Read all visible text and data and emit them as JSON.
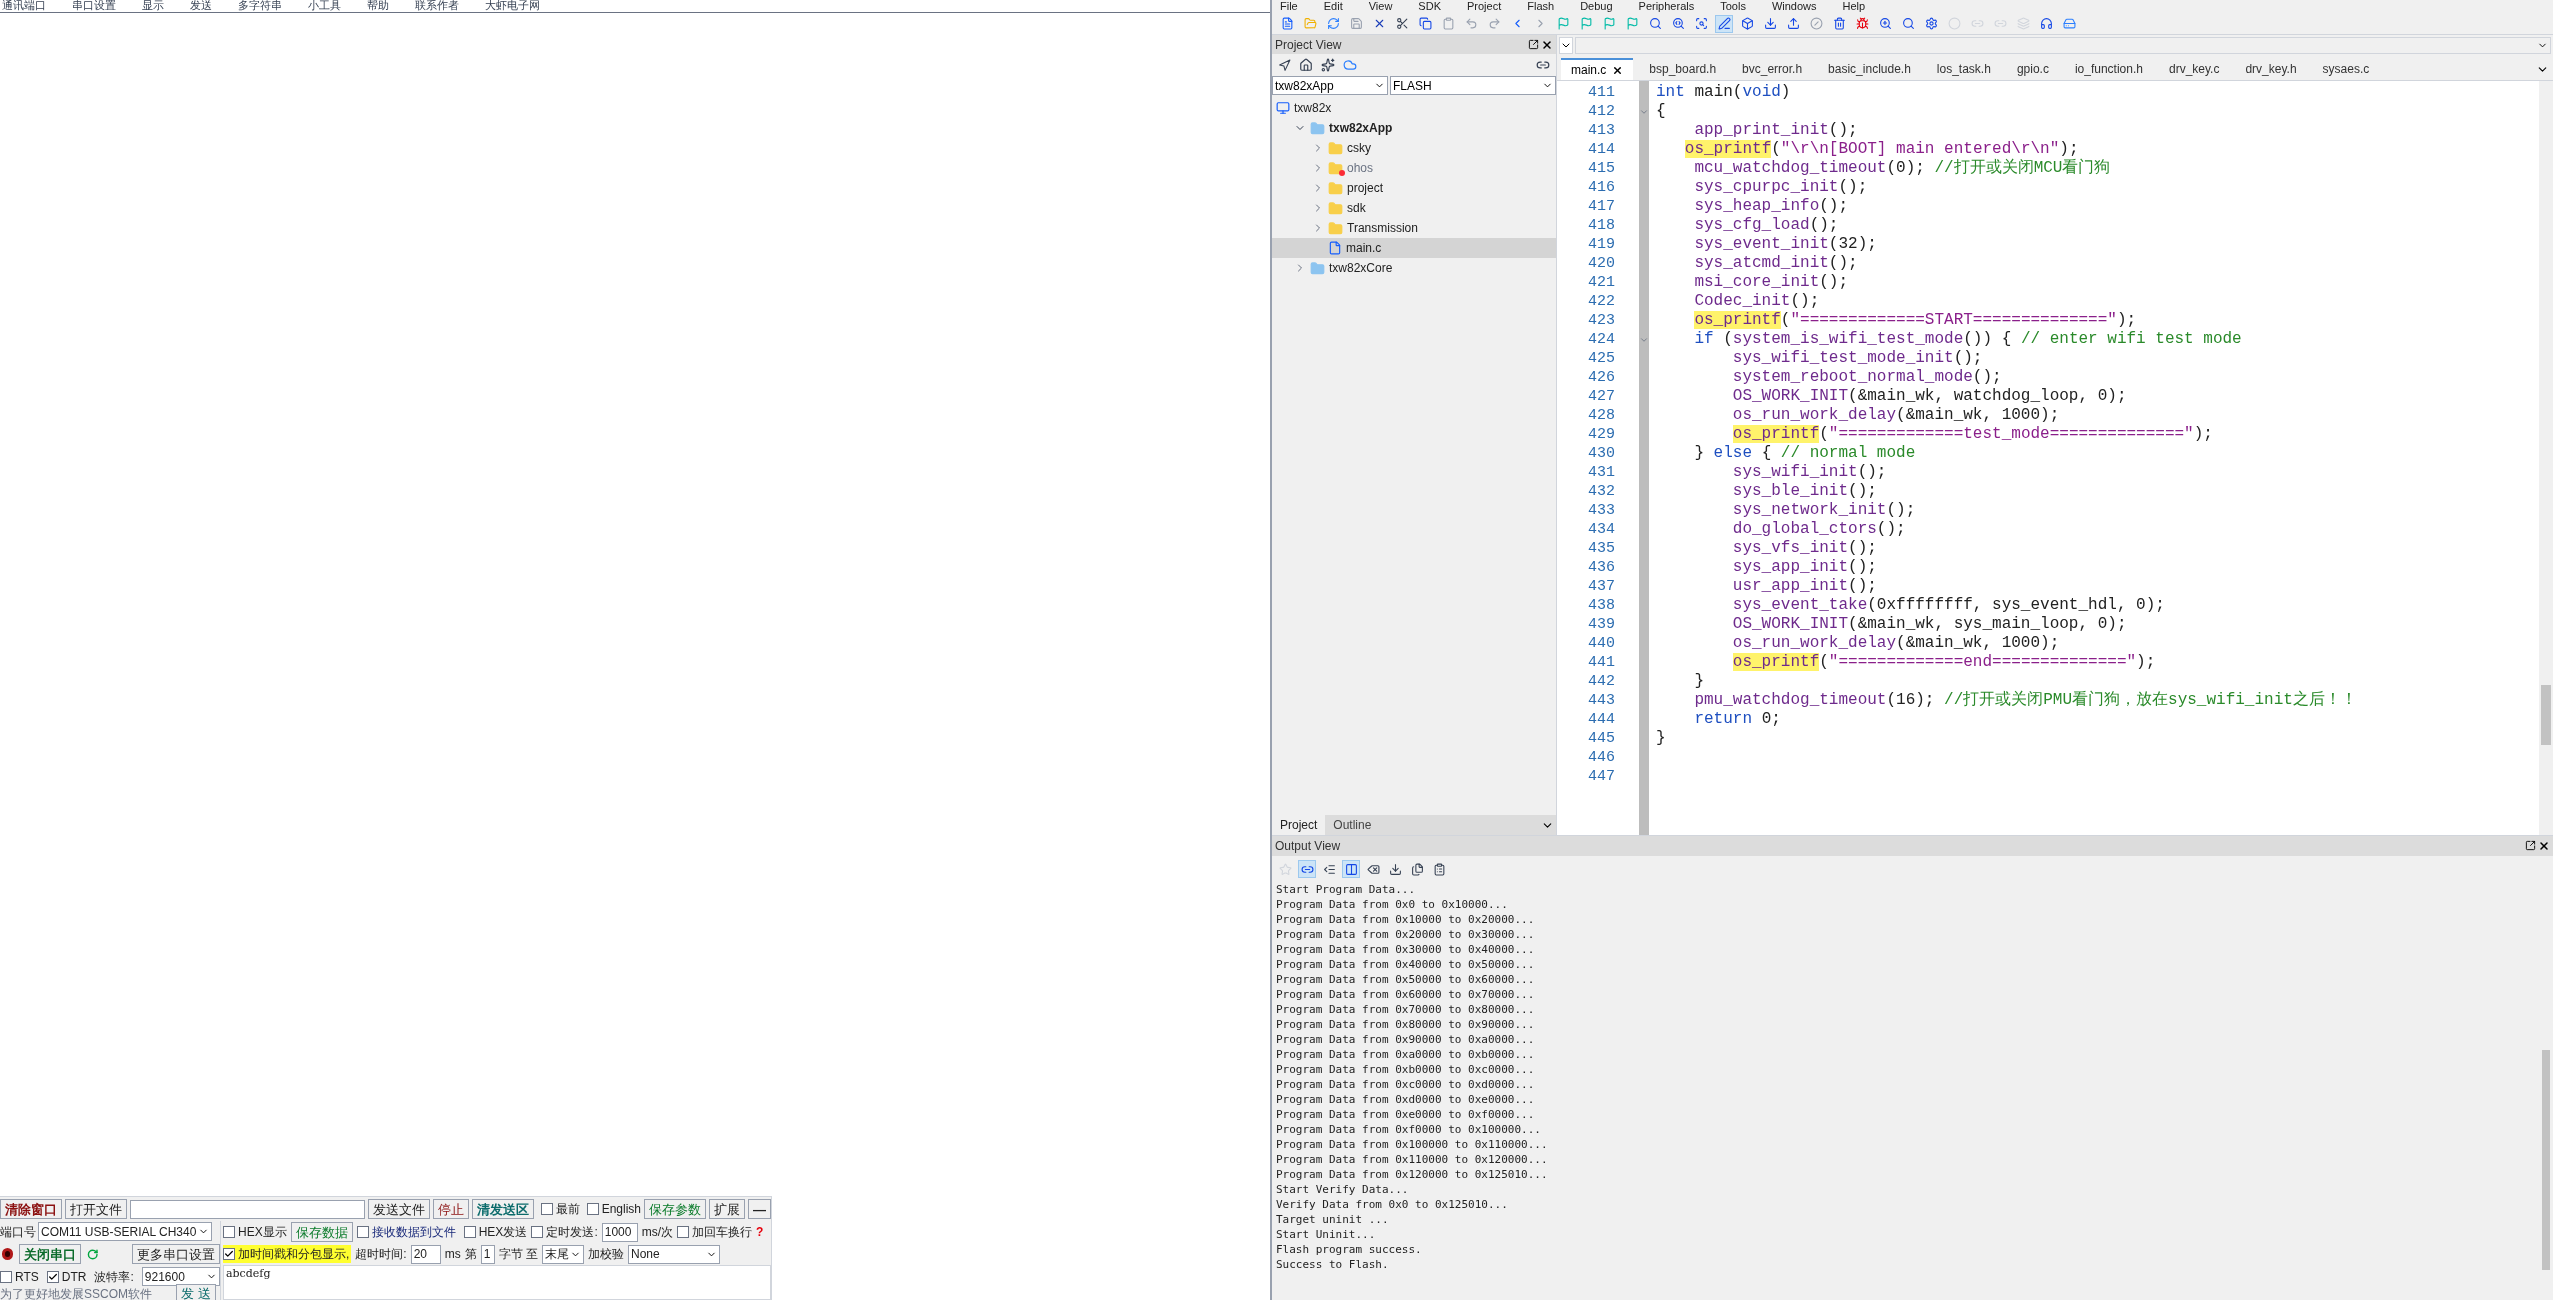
{
  "serial_tool": {
    "menu": [
      "通讯端口",
      "串口设置",
      "显示",
      "发送",
      "多字符串",
      "小工具",
      "帮助",
      "联系作者",
      "大虾电子网"
    ],
    "clear_window_button": "清除窗口",
    "open_file_button": "打开文件",
    "send_file_button": "发送文件",
    "stop_button": "停止",
    "clear_send_button": "清发送区",
    "topmost": {
      "label": "最前",
      "checked": false
    },
    "english": {
      "label": "English",
      "checked": false
    },
    "save_params_button": "保存参数",
    "expand_button": "扩展",
    "collapse_button": "—",
    "port_label": "端口号",
    "port": {
      "value": "COM11 USB-SERIAL CH340"
    },
    "hex_display": {
      "label": "HEX显示",
      "checked": false
    },
    "save_data_button": "保存数据",
    "receive_to_file": {
      "label": "接收数据到文件",
      "checked": false
    },
    "hex_send": {
      "label": "HEX发送",
      "checked": false
    },
    "timed_send": {
      "label": "定时发送:",
      "checked": false
    },
    "interval": {
      "value": "1000"
    },
    "interval_unit": "ms/次",
    "append_crlf": {
      "label": "加回车换行",
      "checked": false
    },
    "help_mark": "?",
    "port_open": true,
    "close_port_button": "关闭串口",
    "more_settings_button": "更多串口设置",
    "timestamp": {
      "label": "加时间戳和分包显示,",
      "checked": true
    },
    "timeout_label": "超时时间:",
    "timeout": {
      "value": "20"
    },
    "timeout_unit": "ms",
    "byte_from_label": "第",
    "byte_from": {
      "value": "1"
    },
    "byte_to_label": "字节 至",
    "byte_to": {
      "value": "末尾"
    },
    "checksum_label": "加校验",
    "checksum": {
      "value": "None"
    },
    "rts": {
      "label": "RTS",
      "checked": false
    },
    "dtr": {
      "label": "DTR",
      "checked": true
    },
    "baud_label": "波特率:",
    "baud": {
      "value": "921600"
    },
    "send_text": {
      "value": "abcdefg"
    },
    "promo": "为了更好地发展SSCOM软件",
    "send_button": "发 送"
  },
  "ide": {
    "menu": [
      "File",
      "Edit",
      "View",
      "SDK",
      "Project",
      "Flash",
      "Debug",
      "Peripherals",
      "Tools",
      "Windows",
      "Help"
    ],
    "toolbar": [
      {
        "on": false
      },
      {
        "on": false
      },
      {
        "on": false
      },
      {
        "on": false
      },
      {
        "on": false
      },
      {
        "on": false
      },
      {
        "on": false
      },
      {
        "on": false
      },
      {
        "on": false
      },
      {
        "on": false
      },
      {
        "on": false
      },
      {
        "on": false
      },
      {
        "on": false
      },
      {
        "on": false
      },
      {
        "on": false
      },
      {
        "on": false
      },
      {
        "on": false
      },
      {
        "on": false
      },
      {
        "on": false
      },
      {
        "on": true
      },
      {
        "on": false
      },
      {
        "on": false
      },
      {
        "on": false
      },
      {
        "on": false
      },
      {
        "on": false
      },
      {
        "on": false
      },
      {
        "on": false
      },
      {
        "on": false
      },
      {
        "on": false
      },
      {
        "on": false
      },
      {
        "on": false
      },
      {
        "on": false
      },
      {
        "on": false
      },
      {
        "on": false
      },
      {
        "on": false
      }
    ],
    "project_view": {
      "title": "Project View",
      "target": {
        "value": "txw82xApp"
      },
      "config": {
        "value": "FLASH"
      },
      "tree": [
        {
          "label": "txw82x",
          "kind": "workspace",
          "selected": false,
          "children": [
            {
              "label": "txw82xApp",
              "kind": "project",
              "expanded": true,
              "selected": false,
              "children": [
                {
                  "label": "csky",
                  "kind": "folder",
                  "expanded": false,
                  "selected": false,
                  "excluded": false
                },
                {
                  "label": "ohos",
                  "kind": "folder",
                  "expanded": false,
                  "selected": false,
                  "excluded": true
                },
                {
                  "label": "project",
                  "kind": "folder",
                  "expanded": false,
                  "selected": false,
                  "excluded": false
                },
                {
                  "label": "sdk",
                  "kind": "folder",
                  "expanded": false,
                  "selected": false,
                  "excluded": false
                },
                {
                  "label": "Transmission",
                  "kind": "folder",
                  "expanded": false,
                  "selected": false,
                  "excluded": false
                },
                {
                  "label": "main.c",
                  "kind": "file",
                  "selected": true
                }
              ]
            },
            {
              "label": "txw82xCore",
              "kind": "project",
              "expanded": false,
              "selected": false
            }
          ]
        }
      ],
      "tabs": [
        {
          "label": "Project",
          "selected": true
        },
        {
          "label": "Outline",
          "selected": false
        }
      ]
    },
    "editor": {
      "tabs": [
        {
          "label": "main.c",
          "selected": true,
          "closable": true
        },
        {
          "label": "bsp_board.h",
          "selected": false
        },
        {
          "label": "bvc_error.h",
          "selected": false
        },
        {
          "label": "basic_include.h",
          "selected": false
        },
        {
          "label": "los_task.h",
          "selected": false
        },
        {
          "label": "gpio.c",
          "selected": false
        },
        {
          "label": "io_function.h",
          "selected": false
        },
        {
          "label": "drv_key.c",
          "selected": false
        },
        {
          "label": "drv_key.h",
          "selected": false
        },
        {
          "label": "sysaes.c",
          "selected": false
        }
      ],
      "lines": [
        {
          "number": "411",
          "segments": [
            {
              "kind": "kw",
              "text": "int"
            },
            {
              "kind": "txt",
              "text": " main("
            },
            {
              "kind": "kw",
              "text": "void"
            },
            {
              "kind": "txt",
              "text": ")"
            }
          ]
        },
        {
          "number": "412",
          "fold": true,
          "segments": [
            {
              "kind": "txt",
              "text": "{"
            }
          ]
        },
        {
          "number": "413",
          "segments": [
            {
              "kind": "fn",
              "text": "    app_print_init"
            },
            {
              "kind": "txt",
              "text": "();"
            }
          ]
        },
        {
          "number": "414",
          "segments": [
            {
              "kind": "hl",
              "text": "   os_printf"
            },
            {
              "kind": "txt",
              "text": "("
            },
            {
              "kind": "str",
              "text": "\"\\r\\n[BOOT] main entered\\r\\n\""
            },
            {
              "kind": "txt",
              "text": ");"
            }
          ]
        },
        {
          "number": "415",
          "segments": [
            {
              "kind": "fn",
              "text": "    mcu_watchdog_timeout"
            },
            {
              "kind": "txt",
              "text": "(0); "
            },
            {
              "kind": "cmt",
              "text": "//打开或关闭MCU看门狗"
            }
          ]
        },
        {
          "number": "416",
          "segments": [
            {
              "kind": "fn",
              "text": "    sys_cpurpc_init"
            },
            {
              "kind": "txt",
              "text": "();"
            }
          ]
        },
        {
          "number": "417",
          "segments": [
            {
              "kind": "fn",
              "text": "    sys_heap_info"
            },
            {
              "kind": "txt",
              "text": "();"
            }
          ]
        },
        {
          "number": "418",
          "segments": [
            {
              "kind": "fn",
              "text": "    sys_cfg_load"
            },
            {
              "kind": "txt",
              "text": "();"
            }
          ]
        },
        {
          "number": "419",
          "segments": [
            {
              "kind": "fn",
              "text": "    sys_event_init"
            },
            {
              "kind": "txt",
              "text": "(32);"
            }
          ]
        },
        {
          "number": "420",
          "segments": [
            {
              "kind": "fn",
              "text": "    sys_atcmd_init"
            },
            {
              "kind": "txt",
              "text": "();"
            }
          ]
        },
        {
          "number": "421",
          "segments": [
            {
              "kind": "fn",
              "text": "    msi_core_init"
            },
            {
              "kind": "txt",
              "text": "();"
            }
          ]
        },
        {
          "number": "422",
          "segments": [
            {
              "kind": "fn",
              "text": "    Codec_init"
            },
            {
              "kind": "txt",
              "text": "();"
            }
          ]
        },
        {
          "number": "423",
          "segments": [
            {
              "kind": "hl",
              "text": "    os_printf"
            },
            {
              "kind": "txt",
              "text": "("
            },
            {
              "kind": "str",
              "text": "\"=============START==============\""
            },
            {
              "kind": "txt",
              "text": ");"
            }
          ]
        },
        {
          "number": "424",
          "fold": true,
          "segments": [
            {
              "kind": "kw",
              "text": "    if"
            },
            {
              "kind": "txt",
              "text": " ("
            },
            {
              "kind": "fn",
              "text": "system_is_wifi_test_mode"
            },
            {
              "kind": "txt",
              "text": "()) { "
            },
            {
              "kind": "cmt",
              "text": "// enter wifi test mode"
            }
          ]
        },
        {
          "number": "425",
          "segments": [
            {
              "kind": "fn",
              "text": "        sys_wifi_test_mode_init"
            },
            {
              "kind": "txt",
              "text": "();"
            }
          ]
        },
        {
          "number": "426",
          "segments": [
            {
              "kind": "fn",
              "text": "        system_reboot_normal_mode"
            },
            {
              "kind": "txt",
              "text": "();"
            }
          ]
        },
        {
          "number": "427",
          "segments": [
            {
              "kind": "fn",
              "text": "        OS_WORK_INIT"
            },
            {
              "kind": "txt",
              "text": "(&main_wk, watchdog_loop, 0);"
            }
          ]
        },
        {
          "number": "428",
          "segments": [
            {
              "kind": "fn",
              "text": "        os_run_work_delay"
            },
            {
              "kind": "txt",
              "text": "(&main_wk, 1000);"
            }
          ]
        },
        {
          "number": "429",
          "segments": [
            {
              "kind": "hl",
              "text": "        os_printf"
            },
            {
              "kind": "txt",
              "text": "("
            },
            {
              "kind": "str",
              "text": "\"=============test_mode==============\""
            },
            {
              "kind": "txt",
              "text": ");"
            }
          ]
        },
        {
          "number": "430",
          "segments": [
            {
              "kind": "txt",
              "text": "    } "
            },
            {
              "kind": "kw",
              "text": "else"
            },
            {
              "kind": "txt",
              "text": " { "
            },
            {
              "kind": "cmt",
              "text": "// normal mode"
            }
          ]
        },
        {
          "number": "431",
          "segments": [
            {
              "kind": "fn",
              "text": "        sys_wifi_init"
            },
            {
              "kind": "txt",
              "text": "();"
            }
          ]
        },
        {
          "number": "432",
          "segments": [
            {
              "kind": "fn",
              "text": "        sys_ble_init"
            },
            {
              "kind": "txt",
              "text": "();"
            }
          ]
        },
        {
          "number": "433",
          "segments": [
            {
              "kind": "fn",
              "text": "        sys_network_init"
            },
            {
              "kind": "txt",
              "text": "();"
            }
          ]
        },
        {
          "number": "434",
          "segments": [
            {
              "kind": "fn",
              "text": "        do_global_ctors"
            },
            {
              "kind": "txt",
              "text": "();"
            }
          ]
        },
        {
          "number": "435",
          "segments": [
            {
              "kind": "fn",
              "text": "        sys_vfs_init"
            },
            {
              "kind": "txt",
              "text": "();"
            }
          ]
        },
        {
          "number": "436",
          "segments": [
            {
              "kind": "fn",
              "text": "        sys_app_init"
            },
            {
              "kind": "txt",
              "text": "();"
            }
          ]
        },
        {
          "number": "437",
          "segments": [
            {
              "kind": "fn",
              "text": "        usr_app_init"
            },
            {
              "kind": "txt",
              "text": "();"
            }
          ]
        },
        {
          "number": "438",
          "segments": [
            {
              "kind": "fn",
              "text": "        sys_event_take"
            },
            {
              "kind": "txt",
              "text": "(0xffffffff, sys_event_hdl, 0);"
            }
          ]
        },
        {
          "number": "439",
          "segments": [
            {
              "kind": "fn",
              "text": "        OS_WORK_INIT"
            },
            {
              "kind": "txt",
              "text": "(&main_wk, sys_main_loop, 0);"
            }
          ]
        },
        {
          "number": "440",
          "segments": [
            {
              "kind": "fn",
              "text": "        os_run_work_delay"
            },
            {
              "kind": "txt",
              "text": "(&main_wk, 1000);"
            }
          ]
        },
        {
          "number": "441",
          "segments": [
            {
              "kind": "hl",
              "text": "        os_printf"
            },
            {
              "kind": "txt",
              "text": "("
            },
            {
              "kind": "str",
              "text": "\"=============end==============\""
            },
            {
              "kind": "txt",
              "text": ");"
            }
          ]
        },
        {
          "number": "442",
          "segments": [
            {
              "kind": "txt",
              "text": "    }"
            }
          ]
        },
        {
          "number": "443",
          "segments": [
            {
              "kind": "fn",
              "text": "    pmu_watchdog_timeout"
            },
            {
              "kind": "txt",
              "text": "(16); "
            },
            {
              "kind": "cmt",
              "text": "//打开或关闭PMU看门狗，放在sys_wifi_init之后！！"
            }
          ]
        },
        {
          "number": "444",
          "segments": [
            {
              "kind": "kw",
              "text": "    return"
            },
            {
              "kind": "txt",
              "text": " 0;"
            }
          ]
        },
        {
          "number": "445",
          "segments": [
            {
              "kind": "txt",
              "text": "}"
            }
          ]
        },
        {
          "number": "446"
        },
        {
          "number": "447"
        }
      ]
    },
    "output_view": {
      "title": "Output View",
      "toolbar": [
        {
          "on": false
        },
        {
          "on": true
        },
        {
          "on": false
        },
        {
          "on": true
        },
        {
          "on": false
        },
        {
          "on": false
        },
        {
          "on": false
        },
        {
          "on": false
        }
      ],
      "lines": [
        "Start Program Data...",
        "Program Data from 0x0 to 0x10000...",
        "Program Data from 0x10000 to 0x20000...",
        "Program Data from 0x20000 to 0x30000...",
        "Program Data from 0x30000 to 0x40000...",
        "Program Data from 0x40000 to 0x50000...",
        "Program Data from 0x50000 to 0x60000...",
        "Program Data from 0x60000 to 0x70000...",
        "Program Data from 0x70000 to 0x80000...",
        "Program Data from 0x80000 to 0x90000...",
        "Program Data from 0x90000 to 0xa0000...",
        "Program Data from 0xa0000 to 0xb0000...",
        "Program Data from 0xb0000 to 0xc0000...",
        "Program Data from 0xc0000 to 0xd0000...",
        "Program Data from 0xd0000 to 0xe0000...",
        "Program Data from 0xe0000 to 0xf0000...",
        "Program Data from 0xf0000 to 0x100000...",
        "Program Data from 0x100000 to 0x110000...",
        "Program Data from 0x110000 to 0x120000...",
        "Program Data from 0x120000 to 0x125010...",
        "Start Verify Data...",
        "Verify Data from 0x0 to 0x125010...",
        "Target uninit ...",
        "Start Uninit...",
        "Flash program success.",
        "Success to Flash."
      ]
    }
  }
}
